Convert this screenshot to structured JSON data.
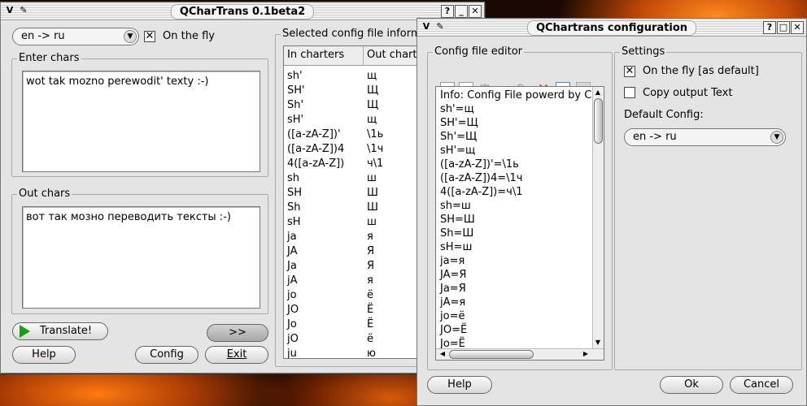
{
  "main_window": {
    "title": "QCharTrans 0.1beta2",
    "language_combo": "en -> ru",
    "on_the_fly_label": "On the fly",
    "enter_chars_title": "Enter chars",
    "enter_chars_text": "wot tak mozno perewodit' texty :-)",
    "out_chars_title": "Out chars",
    "out_chars_text": "вот так мозно переводить тексты :-)",
    "translate_label": "Translate!",
    "more_label": ">>",
    "help_label": "Help",
    "config_label": "Config",
    "exit_label": "Exit",
    "config_info_title": "Selected config file informa",
    "columns": [
      "In charters",
      "Out charte"
    ],
    "rows": [
      [
        "sh'",
        "щ"
      ],
      [
        "SH'",
        "Щ"
      ],
      [
        "Sh'",
        "Щ"
      ],
      [
        "sH'",
        "щ"
      ],
      [
        "([a-zA-Z])'",
        "\\1ь"
      ],
      [
        "([a-zA-Z])4",
        "\\1ч"
      ],
      [
        "4([a-zA-Z])",
        "ч\\1"
      ],
      [
        "sh",
        "ш"
      ],
      [
        "SH",
        "Ш"
      ],
      [
        "Sh",
        "Ш"
      ],
      [
        "sH",
        "ш"
      ],
      [
        "ja",
        "я"
      ],
      [
        "JA",
        "Я"
      ],
      [
        "Ja",
        "Я"
      ],
      [
        "jA",
        "я"
      ],
      [
        "jo",
        "ё"
      ],
      [
        "JO",
        "Ё"
      ],
      [
        "Jo",
        "Ё"
      ],
      [
        "jO",
        "ё"
      ],
      [
        "ju",
        "ю"
      ]
    ]
  },
  "config_window": {
    "title": "QChartrans configuration",
    "editor_group_title": "Config file editor",
    "editor_lines": [
      "Info: Config File powerd by C",
      "sh'=щ",
      "SH'=Щ",
      "Sh'=Щ",
      "sH'=щ",
      "([a-zA-Z])'=\\1ь",
      "([a-zA-Z])4=\\1ч",
      "4([a-zA-Z])=ч\\1",
      "sh=ш",
      "SH=Ш",
      "Sh=Ш",
      "sH=ш",
      "ja=я",
      "JA=Я",
      "Ja=Я",
      "jA=я",
      "jo=ё",
      "JO=Ё",
      "Jo=Ё"
    ],
    "settings_group_title": "Settings",
    "on_the_fly_default_label": "On the fly [as default]",
    "copy_output_label": "Copy output Text",
    "default_config_label": "Default Config:",
    "default_config_value": "en -> ru",
    "help_label": "Help",
    "ok_label": "Ok",
    "cancel_label": "Cancel"
  },
  "toolbar_icons": [
    "new-file-icon",
    "copy-file-icon",
    "paste-icon",
    "cut-icon",
    "find-icon",
    "delete-icon",
    "refresh-icon",
    "blank-icon"
  ]
}
